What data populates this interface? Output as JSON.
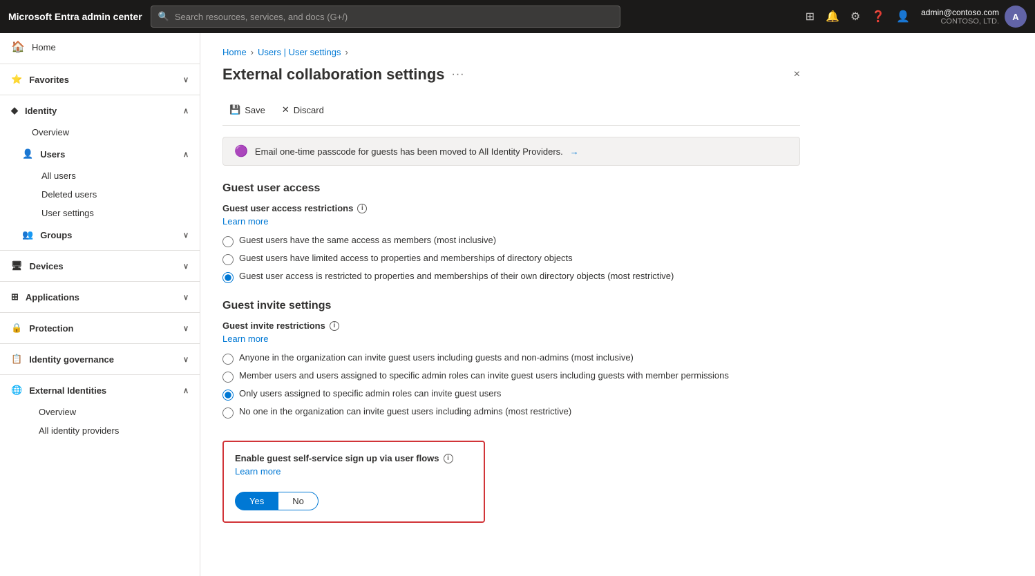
{
  "app": {
    "title": "Microsoft Entra admin center"
  },
  "topbar": {
    "search_placeholder": "Search resources, services, and docs (G+/)",
    "user_name": "admin@contoso.com",
    "user_org": "CONTOSO, LTD.",
    "avatar_initials": "A"
  },
  "sidebar": {
    "home_label": "Home",
    "favorites_label": "Favorites",
    "identity_label": "Identity",
    "overview_label": "Overview",
    "users_label": "Users",
    "all_users_label": "All users",
    "deleted_users_label": "Deleted users",
    "user_settings_label": "User settings",
    "groups_label": "Groups",
    "devices_label": "Devices",
    "applications_label": "Applications",
    "protection_label": "Protection",
    "identity_governance_label": "Identity governance",
    "external_identities_label": "External Identities",
    "ext_overview_label": "Overview",
    "all_identity_providers_label": "All identity providers"
  },
  "breadcrumb": {
    "home": "Home",
    "users_settings": "Users | User settings"
  },
  "page": {
    "title": "External collaboration settings",
    "close_label": "×"
  },
  "toolbar": {
    "save_label": "Save",
    "discard_label": "Discard"
  },
  "banner": {
    "message": "Email one-time passcode for guests has been moved to All Identity Providers.",
    "arrow": "→"
  },
  "guest_user_access": {
    "section_title": "Guest user access",
    "field_label": "Guest user access restrictions",
    "learn_more": "Learn more",
    "options": [
      "Guest users have the same access as members (most inclusive)",
      "Guest users have limited access to properties and memberships of directory objects",
      "Guest user access is restricted to properties and memberships of their own directory objects (most restrictive)"
    ],
    "selected_index": 2
  },
  "guest_invite": {
    "section_title": "Guest invite settings",
    "field_label": "Guest invite restrictions",
    "learn_more": "Learn more",
    "options": [
      "Anyone in the organization can invite guest users including guests and non-admins (most inclusive)",
      "Member users and users assigned to specific admin roles can invite guest users including guests with member permissions",
      "Only users assigned to specific admin roles can invite guest users",
      "No one in the organization can invite guest users including admins (most restrictive)"
    ],
    "selected_index": 2
  },
  "self_service": {
    "label": "Enable guest self-service sign up via user flows",
    "learn_more": "Learn more",
    "yes_label": "Yes",
    "no_label": "No",
    "active": "yes"
  }
}
